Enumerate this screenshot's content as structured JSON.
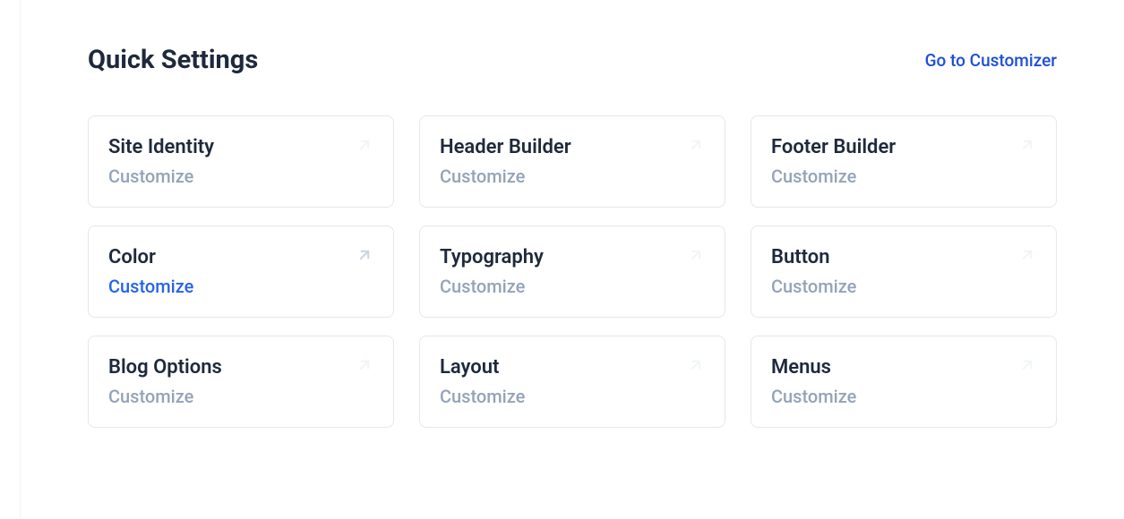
{
  "header": {
    "title": "Quick Settings",
    "go_link": "Go to Customizer"
  },
  "sub_label": "Customize",
  "cards": [
    {
      "title": "Site Identity",
      "active": false
    },
    {
      "title": "Header Builder",
      "active": false
    },
    {
      "title": "Footer Builder",
      "active": false
    },
    {
      "title": "Color",
      "active": true
    },
    {
      "title": "Typography",
      "active": false
    },
    {
      "title": "Button",
      "active": false
    },
    {
      "title": "Blog Options",
      "active": false
    },
    {
      "title": "Layout",
      "active": false
    },
    {
      "title": "Menus",
      "active": false
    }
  ]
}
